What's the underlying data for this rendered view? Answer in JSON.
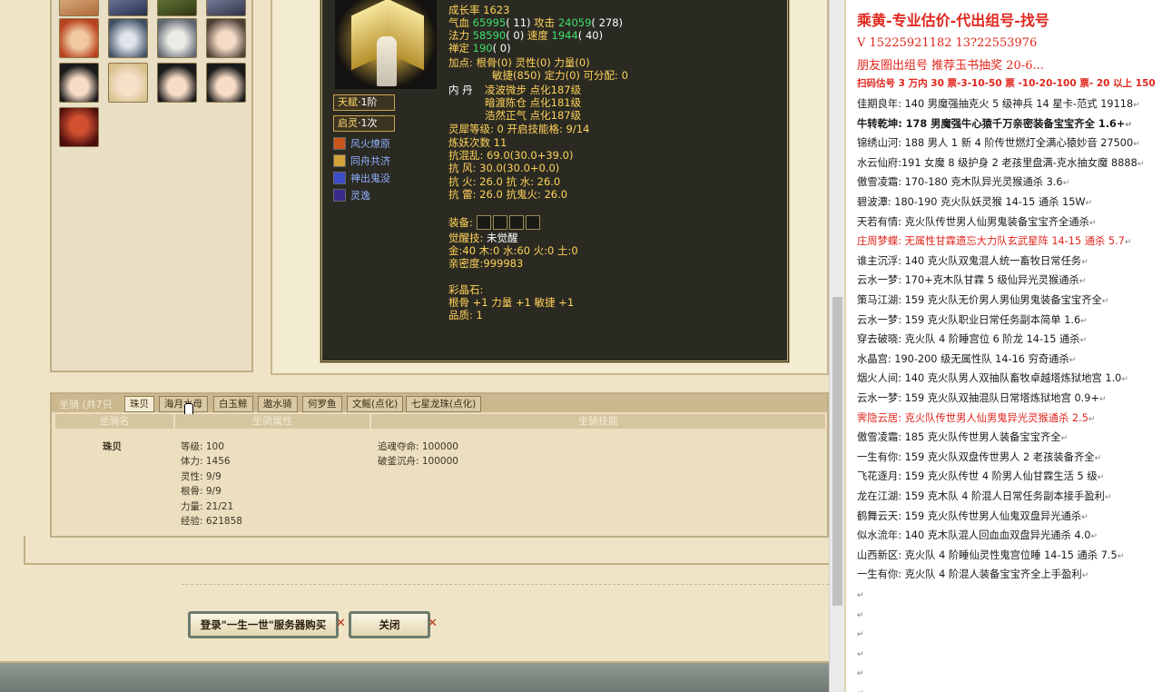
{
  "pet": {
    "growth": "成长率 1623",
    "hp_label": "气血",
    "hp_val": "65995",
    "hp_inc": "( 11)",
    "atk_label": "攻击",
    "atk_val": "24059",
    "atk_inc": "( 278)",
    "mp_label": "法力",
    "mp_val": "58590",
    "mp_inc": "( 0)",
    "spd_label": "速度",
    "spd_val": "1944",
    "spd_inc": "( 40)",
    "zen_label": "禅定",
    "zen_val": "190",
    "zen_inc": "( 0)",
    "points_label": "加点:",
    "points_line1": "根骨(0) 灵性(0) 力量(0)",
    "points_line2": "敏捷(850) 定力(0) 可分配:",
    "points_free": "0",
    "dan_label": "内  丹",
    "dan_1": "凌波微步 点化187级",
    "dan_2": "暗渡陈仓 点化181级",
    "dan_3": "浩然正气 点化187级",
    "xi_label": "灵犀等级:",
    "xi_val": "0 开启技能格: 9/14",
    "refine": "炼妖次数 11",
    "res_1": "抗混乱: 69.0(30.0+39.0)",
    "res_2": "抗  风: 30.0(30.0+0.0)",
    "res_3": "抗  火: 26.0 抗  水: 26.0",
    "res_4": "抗  雷: 26.0 抗鬼火: 26.0",
    "equip_label": "装备:",
    "awaken_label": "觉醒技:",
    "awaken_val": "未觉醒",
    "elements": "金:40 木:0 水:60 火:0 土:0",
    "intimacy": "亲密度:999983",
    "stone_label": "彩晶石:",
    "stone_1": "根骨 +1 力量 +1 敏捷 +1",
    "stone_2": "品质: 1"
  },
  "skills": {
    "tianfu": "天赋",
    "tianfu_lvl": "1阶",
    "qiling": "启灵",
    "qiling_lvl": "1次",
    "list": [
      "风火燎原",
      "同舟共济",
      "神出鬼没",
      "灵逸"
    ]
  },
  "mount": {
    "title": "坐骑 (共7只",
    "tabs": [
      "珠贝",
      "海月水母",
      "白玉鲸",
      "遨水骑",
      "何罗鱼",
      "文鳐(点化)",
      "七星龙珠(点化)"
    ],
    "col_name": "坐骑名",
    "col_attr": "坐骑属性",
    "col_skill": "坐骑技能",
    "name": "珠贝",
    "attrs": [
      "等级: 100",
      "体力: 1456",
      "灵性: 9/9",
      "根骨: 9/9",
      "力量: 21/21",
      "经验: 621858"
    ],
    "skills": [
      "追魂夺命: 100000",
      "破釜沉舟: 100000"
    ]
  },
  "buttons": {
    "buy": "登录\"一生一世\"服务器购买",
    "close": "关闭"
  },
  "doc": {
    "title": "乘黄-专业估价-代出组号-找号",
    "phone": "V    15225921182    13?22553976",
    "friends": "朋友圈出组号  推荐玉书抽奖 20-6...",
    "price": "扫码估号 3 万内 30 票-3-10-50 票  -10-20-100 票- 20 以上 150",
    "lines": [
      {
        "text": "佳期良年: 140 男魔强抽克火 5 级神兵 14 星卡-范式 19118",
        "style": "normal"
      },
      {
        "text": "牛转乾坤: 178 男魔强牛心猿千万亲密装备宝宝齐全 1.6+",
        "style": "bold"
      },
      {
        "text": "锦绣山河: 188 男人 1 新 4 阶传世燃灯全满心猿妙音 27500",
        "style": "normal"
      },
      {
        "text": "水云仙府:191 女魔 8 级护身 2 老孩里盘满-克水抽女魔 8888",
        "style": "normal"
      },
      {
        "text": "傲雪凌霜: 170-180 克木队异光灵猴通杀 3.6",
        "style": "normal"
      },
      {
        "text": "碧波潭: 180-190 克火队妖灵猴 14-15 通杀 15W",
        "style": "normal"
      },
      {
        "text": "天若有情: 克火队传世男人仙男鬼装备宝宝齐全通杀",
        "style": "normal"
      },
      {
        "text": "庄周梦蝶: 无属性甘霖遗忘大力队玄武星阵 14-15 通杀 5.7",
        "style": "red"
      },
      {
        "text": "谁主沉浮: 140 克火队双鬼混人统一畜牧日常任务",
        "style": "normal"
      },
      {
        "text": "云水一梦: 170+克木队甘霖 5 级仙异光灵猴通杀",
        "style": "normal"
      },
      {
        "text": "策马江湖: 159 克火队无价男人男仙男鬼装备宝宝齐全",
        "style": "normal"
      },
      {
        "text": "云水一梦: 159 克火队职业日常任务副本简单 1.6",
        "style": "normal"
      },
      {
        "text": "穿去破晓: 克火队 4 阶睡宫位 6 阶龙 14-15 通杀",
        "style": "normal"
      },
      {
        "text": "水晶宫: 190-200 级无属性队 14-16 穷奇通杀",
        "style": "normal"
      },
      {
        "text": "烟火人间: 140 克火队男人双抽队畜牧卓越塔炼狱地宫 1.0",
        "style": "normal"
      },
      {
        "text": "云水一梦: 159 克火队双抽混队日常塔炼狱地宫 0.9+",
        "style": "normal"
      },
      {
        "text": "霁隐云居: 克火队传世男人仙男鬼异光灵猴通杀 2.5",
        "style": "red"
      },
      {
        "text": "傲雪凌霜: 185 克火队传世男人装备宝宝齐全",
        "style": "normal"
      },
      {
        "text": "一生有你: 159 克火队双盘传世男人 2 老孩装备齐全",
        "style": "normal"
      },
      {
        "text": "飞花逐月: 159 克火队传世 4 阶男人仙甘霖生活 5 级",
        "style": "normal"
      },
      {
        "text": "龙在江湖: 159 克木队 4 阶混人日常任务副本接手盈利",
        "style": "normal"
      },
      {
        "text": "鹤舞云天: 159 克火队传世男人仙鬼双盘异光通杀",
        "style": "normal"
      },
      {
        "text": "似水流年: 140 克木队混人回血血双盘异光通杀 4.0",
        "style": "normal"
      },
      {
        "text": "山西新区: 克火队 4 阶睡仙灵性鬼宫位睡 14-15 通杀 7.5",
        "style": "normal"
      },
      {
        "text": "一生有你: 克火队 4 阶混人装备宝宝齐全上手盈利",
        "style": "normal"
      }
    ],
    "para_mark": "↵"
  }
}
